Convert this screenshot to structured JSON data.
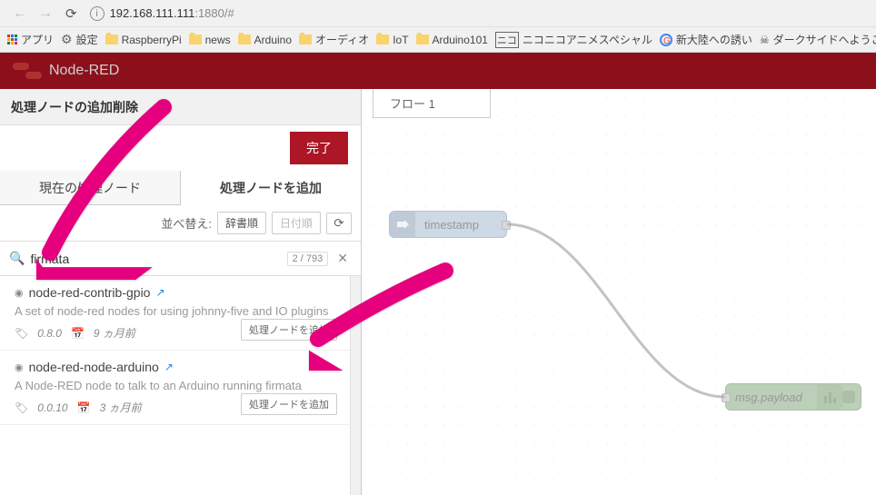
{
  "browser": {
    "url_host": "192.168.111.111",
    "url_port": ":1880",
    "url_path": "/#"
  },
  "bookmarks": {
    "apps": "アプリ",
    "settings": "設定",
    "items": [
      "RaspberryPi",
      "news",
      "Arduino",
      "オーディオ",
      "IoT",
      "Arduino101"
    ],
    "nico": "ニコニコアニメスペシャル",
    "shin": "新大陸への誘い",
    "dark": "ダークサイドへようこそ"
  },
  "header": {
    "title": "Node-RED"
  },
  "panel": {
    "title": "処理ノードの追加削除",
    "done": "完了",
    "tabs": {
      "current": "現在の処理ノード",
      "add": "処理ノードを追加"
    },
    "sort": {
      "label": "並べ替え:",
      "dict": "辞書順",
      "date": "日付順"
    },
    "search": {
      "value": "firmata",
      "count": "2 / 793"
    },
    "results": [
      {
        "name": "node-red-contrib-gpio",
        "desc": "A set of node-red nodes for using johnny-five and IO plugins",
        "version": "0.8.0",
        "age": "9 ヵ月前",
        "btn": "処理ノードを追加"
      },
      {
        "name": "node-red-node-arduino",
        "desc": "A Node-RED node to talk to an Arduino running firmata",
        "version": "0.0.10",
        "age": "3 ヵ月前",
        "btn": "処理ノードを追加"
      }
    ]
  },
  "flow": {
    "tab": "フロー 1",
    "inject": "timestamp",
    "debug": "msg.payload"
  }
}
